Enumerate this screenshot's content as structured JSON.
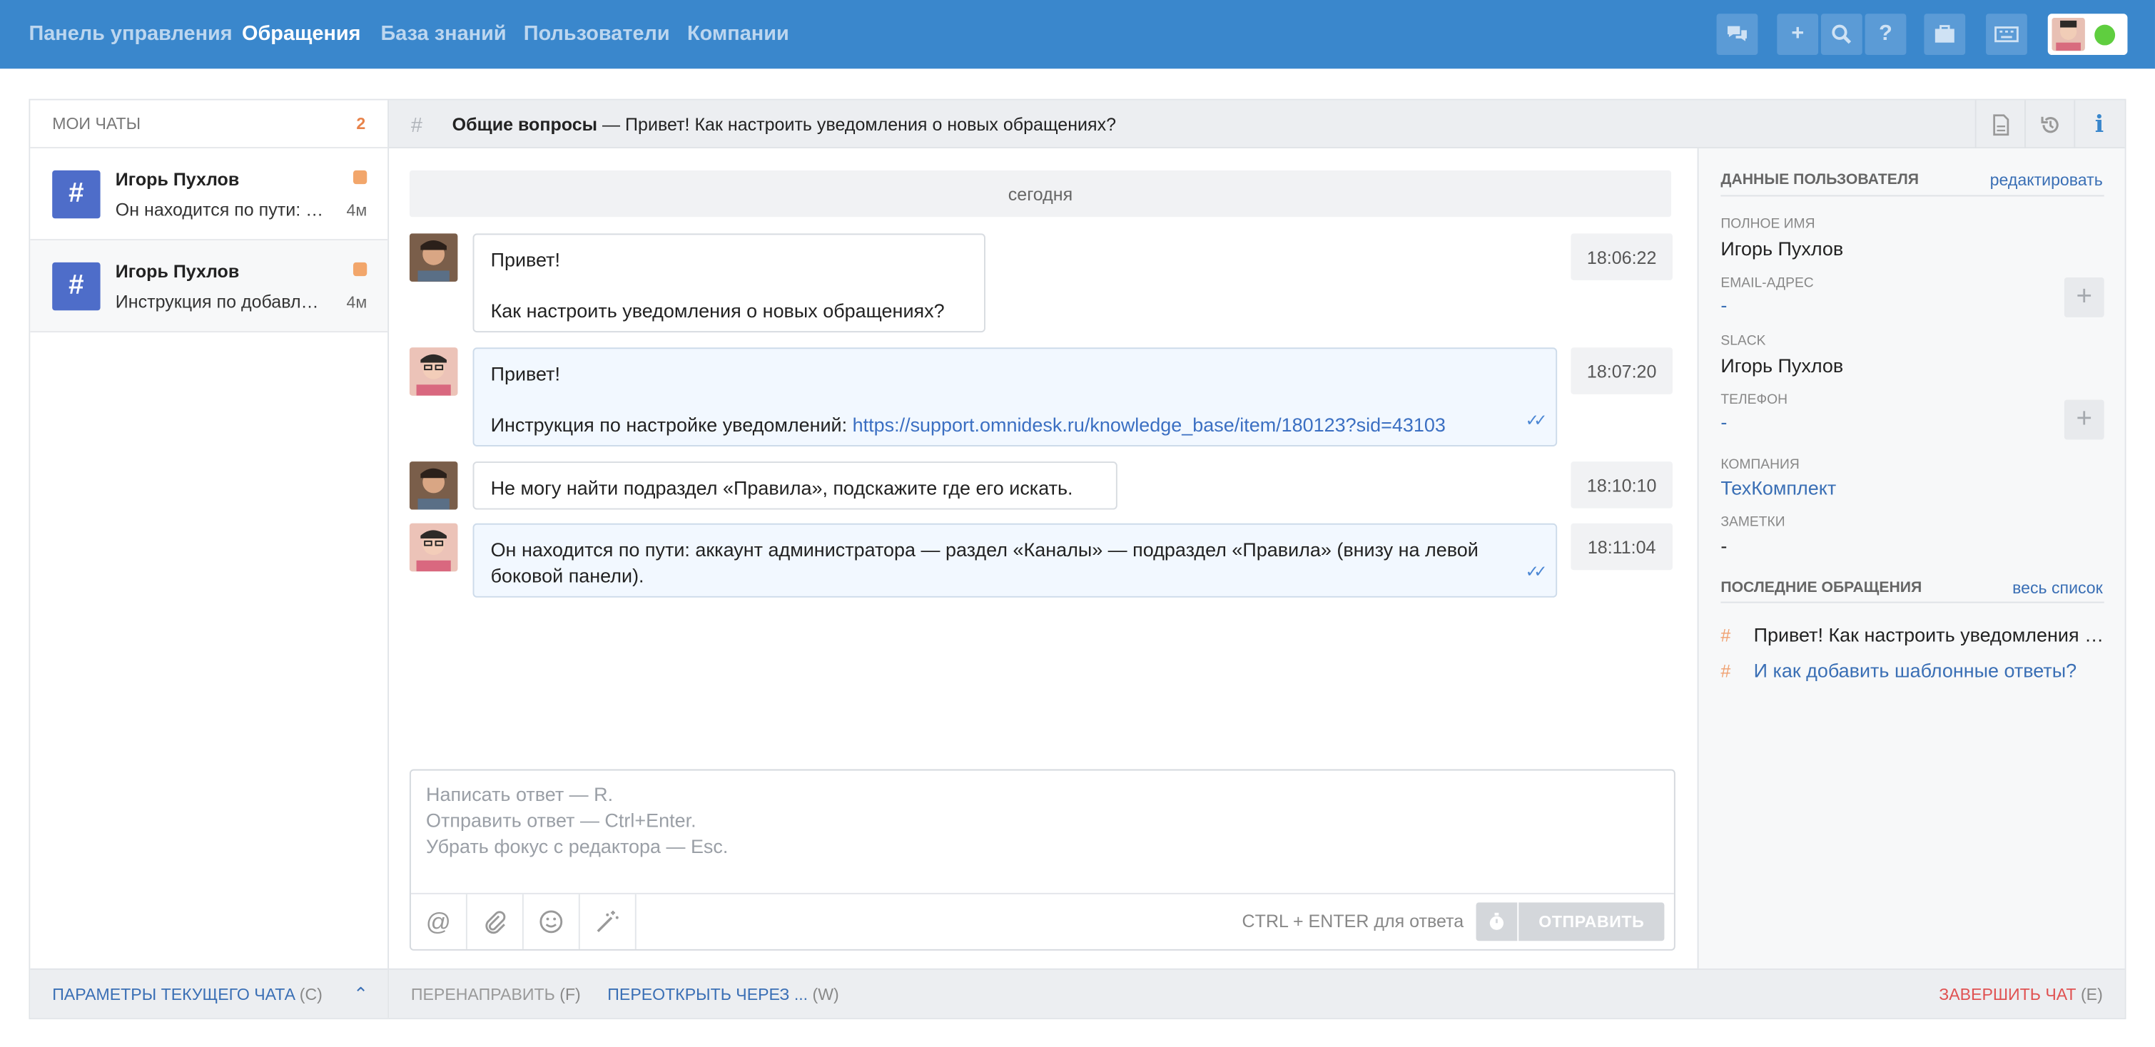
{
  "nav": {
    "items": [
      "Панель управления",
      "Обращения",
      "База знаний",
      "Пользователи",
      "Компании"
    ],
    "active_index": 1
  },
  "toolbar": {
    "icons": [
      "chat-bubbles-icon",
      "plus-icon",
      "search-icon",
      "help-icon",
      "briefcase-icon",
      "keyboard-icon"
    ],
    "status_color": "#5fce3f"
  },
  "left": {
    "title": "МОИ ЧАТЫ",
    "count": "2",
    "chats": [
      {
        "name": "Игорь Пухлов",
        "preview": "Он находится по пути: аккаунт администратора",
        "time": "4м"
      },
      {
        "name": "Игорь Пухлов",
        "preview": "Инструкция по добавлению шаблонных ответов",
        "time": "4м"
      }
    ],
    "footer": {
      "label": "ПАРАМЕТРЫ ТЕКУЩЕГО ЧАТА",
      "key": "(C)"
    }
  },
  "header": {
    "channel": "Общие вопросы",
    "dash": "—",
    "subject": "Привет! Как настроить уведомления о новых обращениях?"
  },
  "feed": {
    "day": "сегодня",
    "messages": [
      {
        "author": "client",
        "line1": "Привет!",
        "line2": "Как настроить уведомления о новых обращениях?",
        "time": "18:06:22"
      },
      {
        "author": "agent",
        "line1": "Привет!",
        "line2": "Инструкция по настройке уведомлений:",
        "link": "https://support.omnidesk.ru/knowledge_base/item/180123?sid=43103",
        "time": "18:07:20"
      },
      {
        "author": "client",
        "line1": "Не могу найти подраздел «Правила», подскажите где его искать.",
        "time": "18:10:10"
      },
      {
        "author": "agent",
        "line1": "Он находится по пути: аккаунт администратора — раздел «Каналы» — подраздел «Правила» (внизу на левой боковой панели).",
        "time": "18:11:04"
      }
    ]
  },
  "composer": {
    "placeholder": "Написать ответ — R.\nОтправить ответ — Ctrl+Enter.\nУбрать фокус с редактора — Esc.",
    "hint": "CTRL + ENTER для ответа",
    "send": "ОТПРАВИТЬ"
  },
  "footer": {
    "forward": "ПЕРЕНАПРАВИТЬ",
    "forward_key": "(F)",
    "reopen": "ПЕРЕОТКРЫТЬ ЧЕРЕЗ ...",
    "reopen_key": "(W)",
    "finish": "ЗАВЕРШИТЬ ЧАТ",
    "finish_key": "(E)"
  },
  "user": {
    "title": "ДАННЫЕ ПОЛЬЗОВАТЕЛЯ",
    "edit": "редактировать",
    "full_name_label": "ПОЛНОЕ ИМЯ",
    "full_name": "Игорь Пухлов",
    "email_label": "EMAIL-АДРЕС",
    "email": "-",
    "slack_label": "SLACK",
    "slack": "Игорь Пухлов",
    "phone_label": "ТЕЛЕФОН",
    "phone": "-",
    "company_label": "КОМПАНИЯ",
    "company": "ТехКомплект",
    "notes_label": "ЗАМЕТКИ",
    "notes": "-"
  },
  "recent": {
    "title": "ПОСЛЕДНИЕ ОБРАЩЕНИЯ",
    "all": "весь список",
    "items": [
      "Привет! Как настроить уведомления о новых обращениях?",
      "И как добавить шаблонные ответы?"
    ]
  }
}
